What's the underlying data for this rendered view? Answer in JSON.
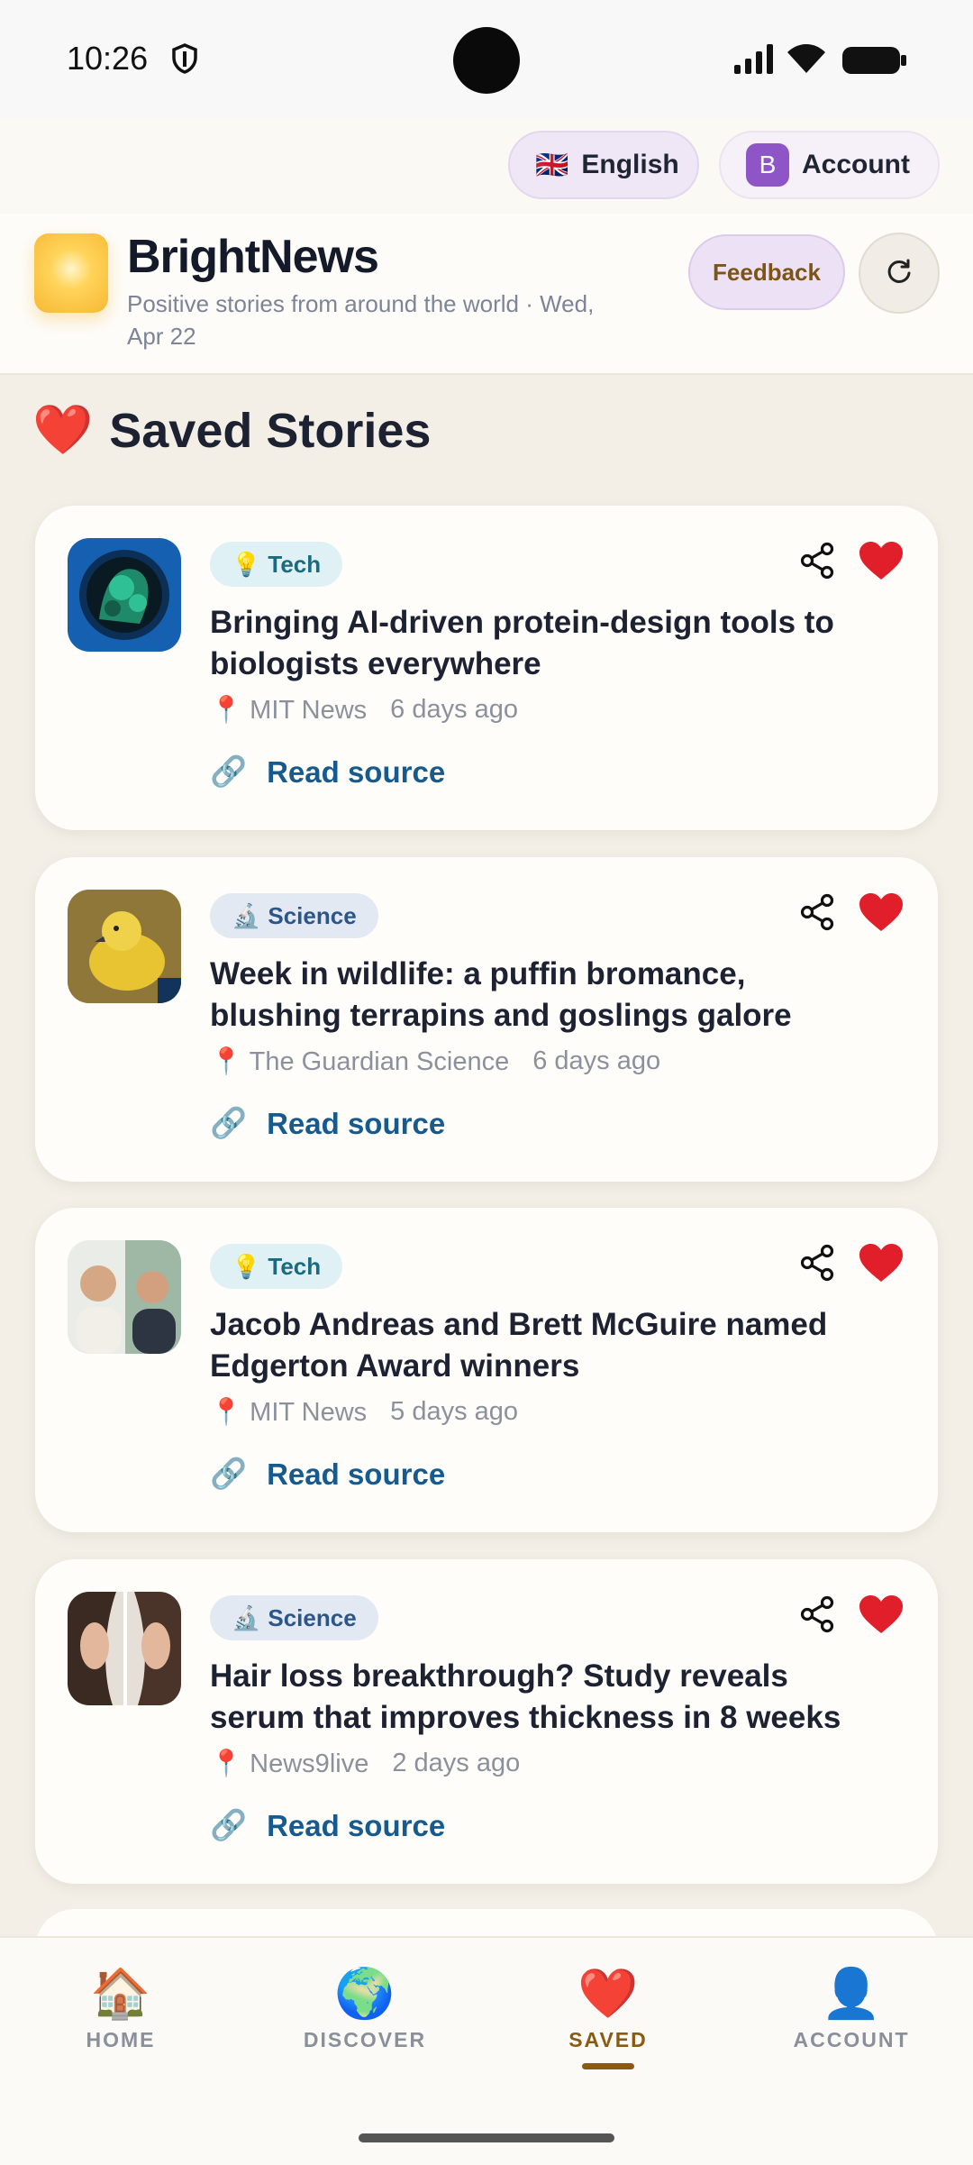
{
  "status_bar": {
    "time": "10:26"
  },
  "topbar": {
    "language_flag": "🇬🇧",
    "language_label": "English",
    "account_initial": "B",
    "account_label": "Account"
  },
  "header": {
    "brand": "BrightNews",
    "tagline": "Positive stories from around the world · Wed, Apr 22",
    "feedback_label": "Feedback"
  },
  "section": {
    "icon": "❤️",
    "title": "Saved Stories"
  },
  "stories": [
    {
      "tag_icon": "💡",
      "tag": "Tech",
      "title": "Bringing AI-driven protein-design tools to biologists everywhere",
      "source": "MIT News",
      "time": "6 days ago",
      "read_label": "Read source"
    },
    {
      "tag_icon": "🔬",
      "tag": "Science",
      "title": "Week in wildlife: a puffin bromance, blushing terrapins and goslings galore",
      "source": "The Guardian Science",
      "time": "6 days ago",
      "read_label": "Read source"
    },
    {
      "tag_icon": "💡",
      "tag": "Tech",
      "title": "Jacob Andreas and Brett McGuire named Edgerton Award winners",
      "source": "MIT News",
      "time": "5 days ago",
      "read_label": "Read source"
    },
    {
      "tag_icon": "🔬",
      "tag": "Science",
      "title": "Hair loss breakthrough? Study reveals serum that improves thickness in 8 weeks",
      "source": "News9live",
      "time": "2 days ago",
      "read_label": "Read source"
    }
  ],
  "meta_icons": {
    "pin": "📍",
    "link": "🔗",
    "heart": "❤️"
  },
  "nav": [
    {
      "icon": "🏠",
      "label": "HOME"
    },
    {
      "icon": "🌍",
      "label": "DISCOVER"
    },
    {
      "icon": "❤️",
      "label": "SAVED"
    },
    {
      "icon": "👤",
      "label": "ACCOUNT"
    }
  ]
}
